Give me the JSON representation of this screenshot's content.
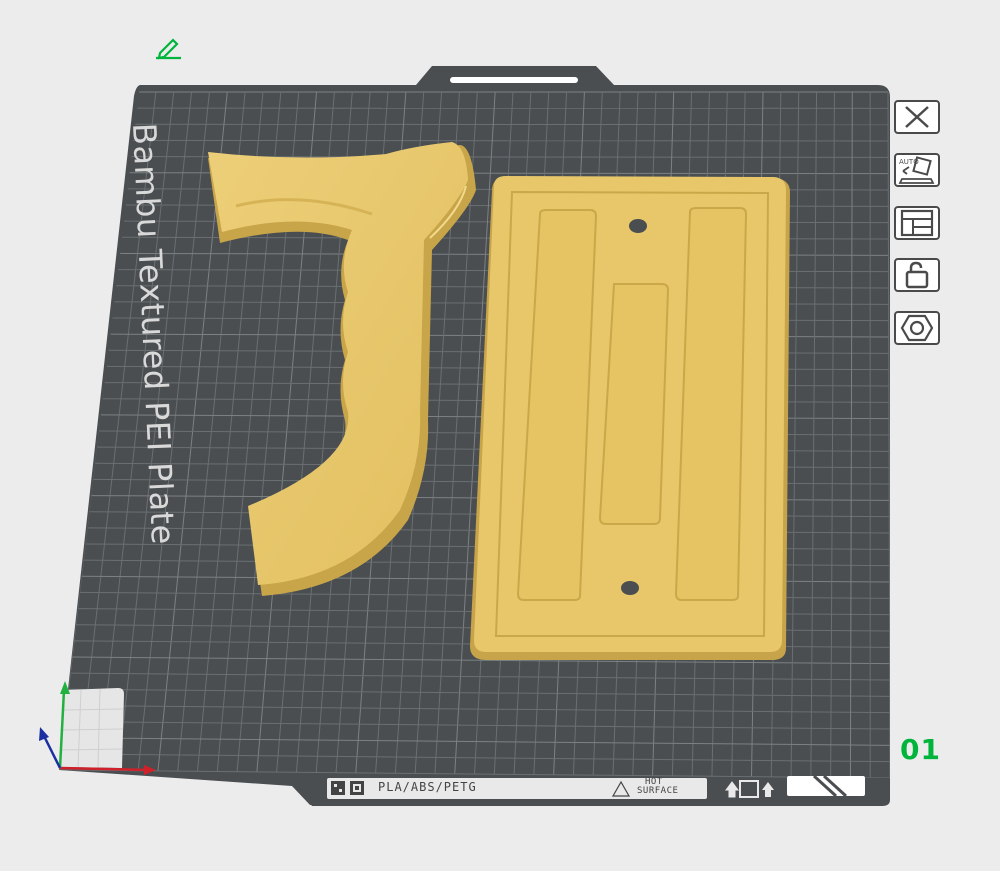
{
  "plate": {
    "name": "Bambu Textured PEI Plate",
    "filament_types": "PLA/ABS/PETG",
    "hot_surface_line1": "HOT",
    "hot_surface_line2": "SURFACE",
    "index": "01"
  },
  "toolbar": {
    "close_icon": "close-icon",
    "auto_orient_label": "AUTO",
    "arrange_icon": "arrange-icon",
    "lock_icon": "unlock-icon",
    "settings_icon": "hex-nut-icon"
  },
  "colors": {
    "bed": "#4a4e51",
    "grid": "#6f7477",
    "model": "#e8c76a",
    "accent_green": "#00b43c",
    "axis_x": "#d0202a",
    "axis_y": "#22b040",
    "axis_z": "#1a30a0"
  }
}
